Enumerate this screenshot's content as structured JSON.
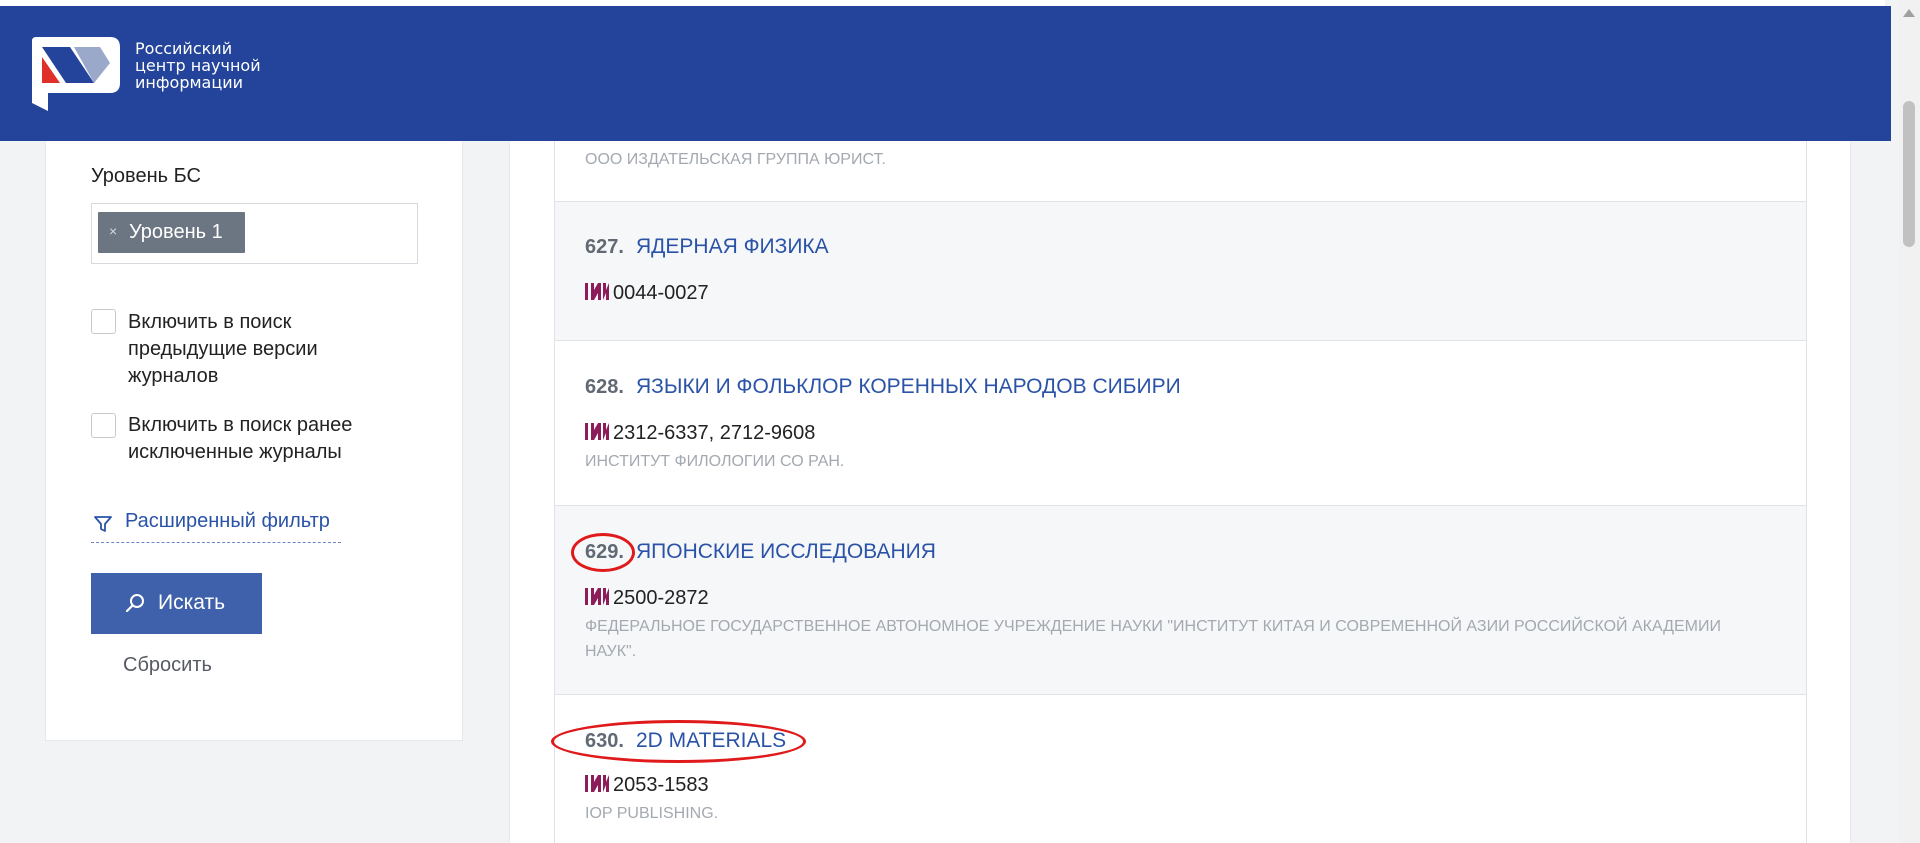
{
  "brand": {
    "line1": "Российский",
    "line2": "центр научной",
    "line3": "информации"
  },
  "sidebar": {
    "bs_label": "Уровень БС",
    "tag_remove": "×",
    "tag_label": "Уровень 1",
    "checkbox1": "Включить в поиск предыдущие версии журналов",
    "checkbox2": "Включить в поиск ранее исключенные журналы",
    "advanced_filter": "Расширенный фильтр",
    "search_button": "Искать",
    "reset": "Сбросить"
  },
  "list": {
    "partial_publisher": "ООО ИЗДАТЕЛЬСКАЯ ГРУППА ЮРИСТ.",
    "items": [
      {
        "num": "627.",
        "title": "ЯДЕРНАЯ ФИЗИКА",
        "issn": "0044-0027",
        "publisher": ""
      },
      {
        "num": "628.",
        "title": "ЯЗЫКИ И ФОЛЬКЛОР КОРЕННЫХ НАРОДОВ СИБИРИ",
        "issn": "2312-6337, 2712-9608",
        "publisher": "ИНСТИТУТ ФИЛОЛОГИИ СО РАН."
      },
      {
        "num": "629.",
        "title": "ЯПОНСКИЕ ИССЛЕДОВАНИЯ",
        "issn": "2500-2872",
        "publisher": "ФЕДЕРАЛЬНОЕ ГОСУДАРСТВЕННОЕ АВТОНОМНОЕ УЧРЕЖДЕНИЕ НАУКИ \"ИНСТИТУТ КИТАЯ И СОВРЕМЕННОЙ АЗИИ РОССИЙСКОЙ АКАДЕМИИ НАУК\"."
      },
      {
        "num": "630.",
        "title": "2D MATERIALS",
        "issn": "2053-1583",
        "publisher": "IOP PUBLISHING."
      }
    ]
  },
  "colors": {
    "header": "#23449a",
    "link": "#2a53a8",
    "annotation": "#e01a1a",
    "issn_icon": "#8c1d5a"
  },
  "icons": [
    "logo-icon",
    "close-icon",
    "filter-icon",
    "search-icon",
    "issn-icon",
    "scroll-up-icon"
  ]
}
